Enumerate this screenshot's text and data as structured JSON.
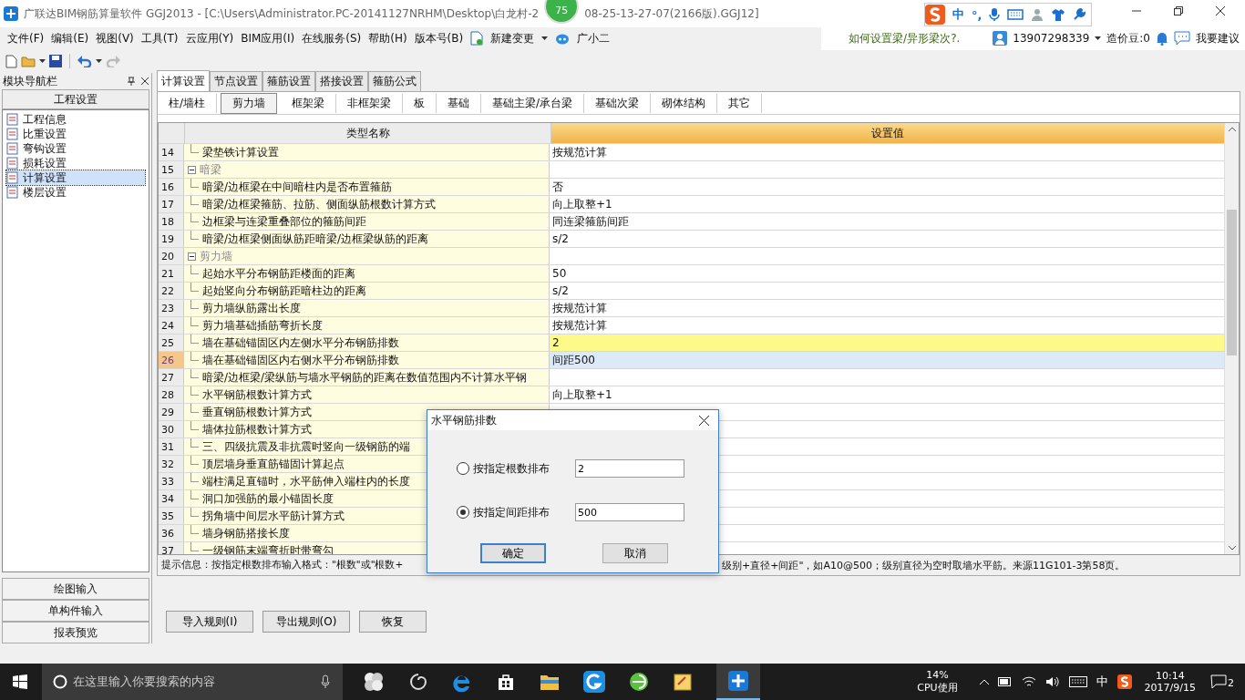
{
  "window": {
    "title": "广联达BIM钢筋算量软件 GGJ2013 - [C:\\Users\\Administrator.PC-20141127NRHM\\Desktop\\白龙村-2",
    "title_tail": "08-25-13-27-07(2166版).GGJ12]",
    "badge": "75"
  },
  "menu": [
    "文件(F)",
    "编辑(E)",
    "视图(V)",
    "工具(T)",
    "云应用(Y)",
    "BIM应用(I)",
    "在线服务(S)",
    "帮助(H)",
    "版本号(B)"
  ],
  "menu_extra": {
    "change": "新建变更",
    "assistant": "广小二"
  },
  "ime_bar": {
    "mode": "中",
    "punct": "°,"
  },
  "top_right": {
    "tip": "如何设置梁/异形梁次?.",
    "account": "13907298339",
    "beans": "造价豆:0",
    "feedback": "我要建议"
  },
  "sidebar": {
    "title": "模块导航栏",
    "section": "工程设置",
    "items": [
      {
        "label": "工程信息",
        "selected": false
      },
      {
        "label": "比重设置",
        "selected": false
      },
      {
        "label": "弯钩设置",
        "selected": false
      },
      {
        "label": "损耗设置",
        "selected": false
      },
      {
        "label": "计算设置",
        "selected": true
      },
      {
        "label": "楼层设置",
        "selected": false
      }
    ],
    "bottom": [
      "绘图输入",
      "单构件输入",
      "报表预览"
    ]
  },
  "tabs": [
    {
      "label": "计算设置",
      "selected": true
    },
    {
      "label": "节点设置",
      "selected": false
    },
    {
      "label": "箍筋设置",
      "selected": false
    },
    {
      "label": "搭接设置",
      "selected": false
    },
    {
      "label": "箍筋公式",
      "selected": false
    }
  ],
  "subtabs": [
    {
      "label": "柱/墙柱",
      "selected": false
    },
    {
      "label": "剪力墙",
      "selected": true
    },
    {
      "label": "框架梁",
      "selected": false
    },
    {
      "label": "非框架梁",
      "selected": false
    },
    {
      "label": "板",
      "selected": false
    },
    {
      "label": "基础",
      "selected": false
    },
    {
      "label": "基础主梁/承台梁",
      "selected": false
    },
    {
      "label": "基础次梁",
      "selected": false
    },
    {
      "label": "砌体结构",
      "selected": false
    },
    {
      "label": "其它",
      "selected": false
    }
  ],
  "table": {
    "columns": [
      "类型名称",
      "设置值"
    ],
    "rows": [
      {
        "num": "14",
        "kind": "item",
        "name": "梁垫铁计算设置",
        "value": "按规范计算",
        "selected": false,
        "highlighted": false
      },
      {
        "num": "15",
        "kind": "group",
        "name": "暗梁",
        "expanded": true,
        "selected": false
      },
      {
        "num": "16",
        "kind": "item",
        "name": "暗梁/边框梁在中间暗柱内是否布置箍筋",
        "value": "否",
        "selected": false,
        "highlighted": false
      },
      {
        "num": "17",
        "kind": "item",
        "name": "暗梁/边框梁箍筋、拉筋、侧面纵筋根数计算方式",
        "value": "向上取整+1",
        "selected": false,
        "highlighted": false
      },
      {
        "num": "18",
        "kind": "item",
        "name": "边框梁与连梁重叠部位的箍筋间距",
        "value": "同连梁箍筋间距",
        "selected": false,
        "highlighted": false
      },
      {
        "num": "19",
        "kind": "item",
        "name": "暗梁/边框梁侧面纵筋距暗梁/边框梁纵筋的距离",
        "value": "s/2",
        "selected": false,
        "highlighted": false
      },
      {
        "num": "20",
        "kind": "group",
        "name": "剪力墙",
        "expanded": true,
        "selected": false
      },
      {
        "num": "21",
        "kind": "item",
        "name": "起始水平分布钢筋距楼面的距离",
        "value": "50",
        "selected": false,
        "highlighted": false
      },
      {
        "num": "22",
        "kind": "item",
        "name": "起始竖向分布钢筋距暗柱边的距离",
        "value": "s/2",
        "selected": false,
        "highlighted": false
      },
      {
        "num": "23",
        "kind": "item",
        "name": "剪力墙纵筋露出长度",
        "value": "按规范计算",
        "selected": false,
        "highlighted": false
      },
      {
        "num": "24",
        "kind": "item",
        "name": "剪力墙基础插筋弯折长度",
        "value": "按规范计算",
        "selected": false,
        "highlighted": false
      },
      {
        "num": "25",
        "kind": "item",
        "name": "墙在基础锚固区内左侧水平分布钢筋排数",
        "value": "2",
        "selected": false,
        "highlighted": true
      },
      {
        "num": "26",
        "kind": "item",
        "name": "墙在基础锚固区内右侧水平分布钢筋排数",
        "value": "间距500",
        "selected": true,
        "highlighted": false
      },
      {
        "num": "27",
        "kind": "item",
        "name": "暗梁/边框梁/梁纵筋与墙水平钢筋的距离在数值范围内不计算水平钢",
        "selected": false
      },
      {
        "num": "28",
        "kind": "item",
        "name": "水平钢筋根数计算方式",
        "value": "向上取整+1",
        "selected": false,
        "highlighted": false
      },
      {
        "num": "29",
        "kind": "item",
        "name": "垂直钢筋根数计算方式",
        "selected": false
      },
      {
        "num": "30",
        "kind": "item",
        "name": "墙体拉筋根数计算方式",
        "selected": false
      },
      {
        "num": "31",
        "kind": "item",
        "name": "三、四级抗震及非抗震时竖向一级钢筋的端",
        "selected": false
      },
      {
        "num": "32",
        "kind": "item",
        "name": "顶层墙身垂直筋锚固计算起点",
        "selected": false
      },
      {
        "num": "33",
        "kind": "item",
        "name": "端柱满足直锚时，水平筋伸入端柱内的长度",
        "selected": false
      },
      {
        "num": "34",
        "kind": "item",
        "name": "洞口加强筋的最小锚固长度",
        "selected": false
      },
      {
        "num": "35",
        "kind": "item",
        "name": "拐角墙中间层水平筋计算方式",
        "selected": false
      },
      {
        "num": "36",
        "kind": "item",
        "name": "墙身钢筋搭接长度",
        "selected": false
      },
      {
        "num": "37",
        "kind": "item",
        "name": "一级钢筋末端弯折时带弯勾",
        "selected": false
      }
    ]
  },
  "hint": {
    "left": "提示信息：按指定根数排布输入格式：\"根数\"或\"根数+",
    "right": "级别+直径+间距\"，如A10@500；级别直径为空时取墙水平筋。来源11G101-3第58页。"
  },
  "buttons": [
    "导入规则(I)",
    "导出规则(O)",
    "恢复"
  ],
  "dialog": {
    "title": "水平钢筋排数",
    "options": [
      {
        "label": "按指定根数排布",
        "selected": false,
        "value": "2"
      },
      {
        "label": "按指定间距排布",
        "selected": true,
        "value": "500"
      }
    ],
    "ok": "确定",
    "cancel": "取消"
  },
  "taskbar": {
    "search": "在这里输入你要搜索的内容",
    "cpu": "14%",
    "cpu_label": "CPU使用",
    "ime": "中",
    "time": "10:14",
    "date": "2017/9/15",
    "notifications": "2"
  }
}
